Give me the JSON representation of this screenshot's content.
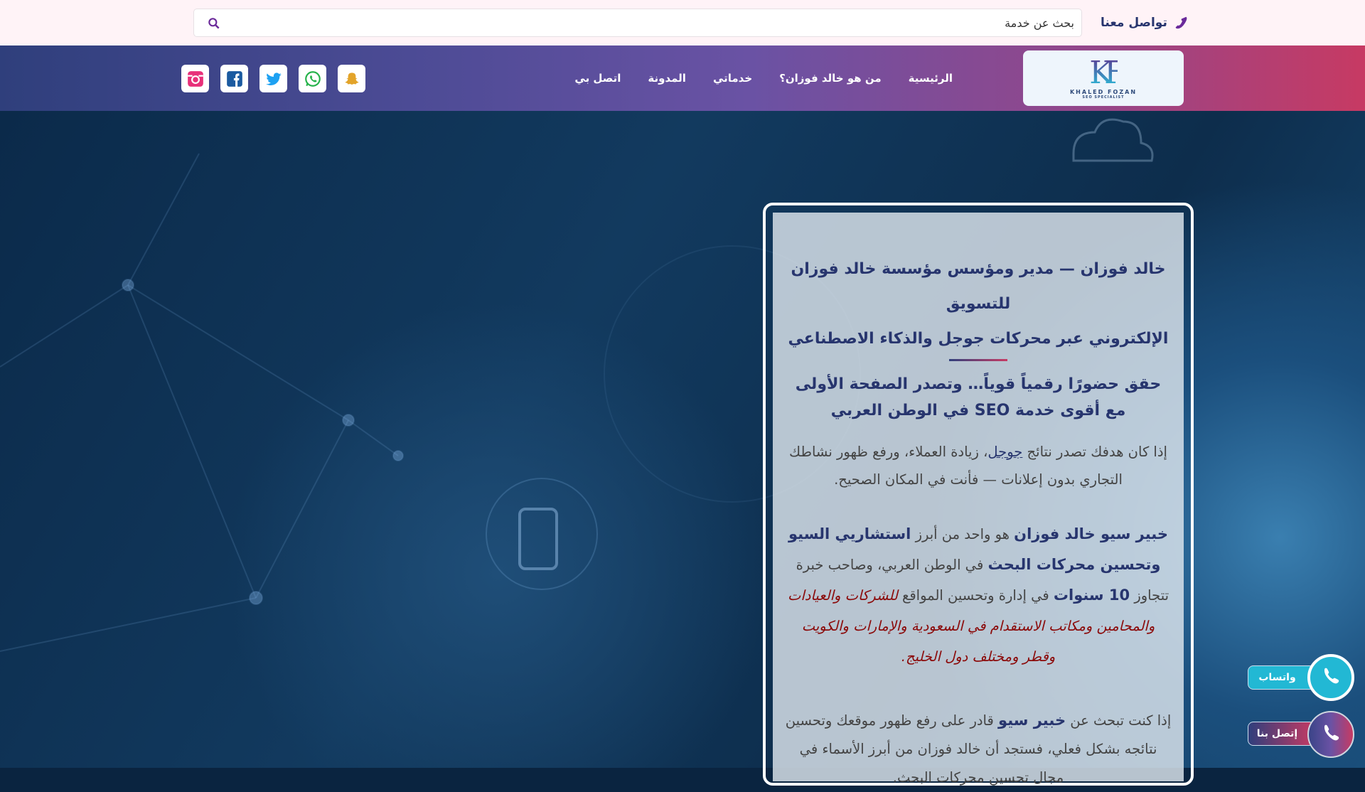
{
  "topbar": {
    "search_placeholder": "بحث عن خدمة",
    "contact_label": "تواصل معنا"
  },
  "logo": {
    "mark": "KF",
    "name": "KHALED FOZAN",
    "tagline": "SEO SPECIALIST"
  },
  "nav": {
    "items": [
      {
        "label": "الرئيسية"
      },
      {
        "label": "من هو خالد فوزان؟"
      },
      {
        "label": "خدماتي"
      },
      {
        "label": "المدونة"
      },
      {
        "label": "اتصل بي"
      }
    ]
  },
  "social": [
    "instagram",
    "facebook",
    "twitter",
    "whatsapp",
    "snapchat"
  ],
  "card": {
    "title_line1": "خالد فوزان — مدير ومؤسس مؤسسة خالد فوزان للتسويق",
    "title_line2": "الإلكتروني عبر محركات جوجل والذكاء الاصطناعي",
    "subtitle": "حقق حضورًا رقمياً قوياً… وتصدر الصفحة الأولى مع أقوى خدمة SEO في الوطن العربي",
    "p1_a": "إذا كان هدفك تصدر نتائج ",
    "p1_link": "جوجل",
    "p1_b": "، زيادة العملاء، ورفع ظهور نشاطك التجاري بدون إعلانات — فأنت في المكان الصحيح.",
    "p2_b1": "خبير سيو خالد فوزان",
    "p2_t1": " هو واحد من أبرز ",
    "p2_b2": "استشاريي السيو وتحسين محركات البحث",
    "p2_t2": " في الوطن العربي، وصاحب خبرة تتجاوز ",
    "p2_b3": "10 سنوات",
    "p2_t3": " في إدارة وتحسين المواقع ",
    "p2_i": "للشركات والعيادات والمحامين ومكاتب الاستقدام في السعودية والإمارات والكويت وقطر ومختلف دول الخليج.",
    "p3_t1": "إذا كنت تبحث عن ",
    "p3_b": "خبير سيو",
    "p3_t2": " قادر على رفع ظهور موقعك وتحسين نتائجه بشكل فعلي، فستجد أن خالد فوزان من أبرز الأسماء في مجال تحسين محركات البحث."
  },
  "floating": {
    "whatsapp_label": "واتساب",
    "call_label": "إتصل بنا"
  },
  "colors": {
    "primary": "#27356e",
    "accent": "#c73a63",
    "whatsapp": "#22b8d4"
  }
}
